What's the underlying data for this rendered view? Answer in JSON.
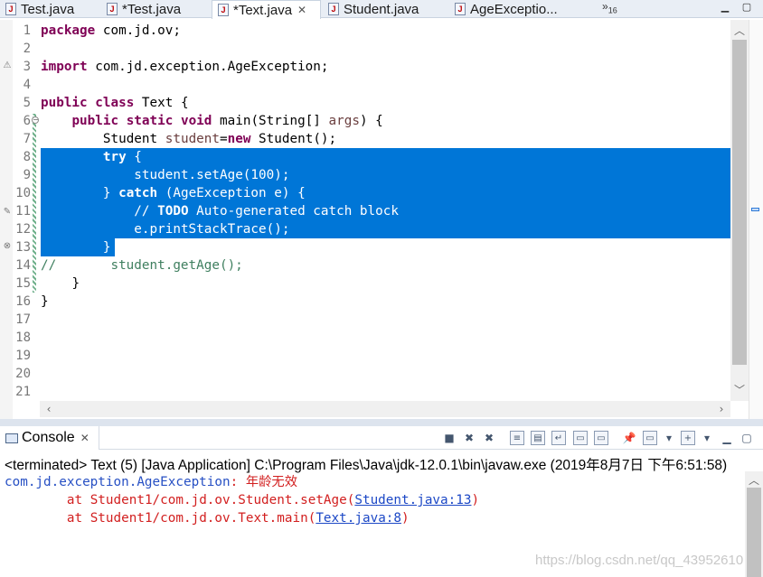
{
  "tabs": [
    {
      "label": "Test.java",
      "active": false,
      "icon": "java-file-icon"
    },
    {
      "label": "*Test.java",
      "active": false,
      "icon": "java-file-error-icon"
    },
    {
      "label": "*Text.java",
      "active": true,
      "icon": "java-file-icon"
    },
    {
      "label": "Student.java",
      "active": false,
      "icon": "java-file-icon"
    },
    {
      "label": "AgeExceptio...",
      "active": false,
      "icon": "java-file-icon"
    }
  ],
  "active_close": "✕",
  "tabs_more": {
    "symbol": "»",
    "count": "16"
  },
  "line_numbers": [
    "1",
    "2",
    "3",
    "4",
    "5",
    "6",
    "7",
    "8",
    "9",
    "10",
    "11",
    "12",
    "13",
    "14",
    "15",
    "16",
    "17",
    "18",
    "19",
    "20",
    "21"
  ],
  "code": {
    "l1_kw": "package",
    "l1_rest": " com.jd.ov;",
    "l3_kw": "import",
    "l3_rest": " com.jd.exception.AgeException;",
    "l5_kw1": "public",
    "l5_kw2": "class",
    "l5_rest": " Text {",
    "l6_kw1": "public",
    "l6_kw2": "static",
    "l6_kw3": "void",
    "l6_a": " main(String[] ",
    "l6_var": "args",
    "l6_b": ") {",
    "l7_a": "Student ",
    "l7_var": "student",
    "l7_b": "=",
    "l7_kw": "new",
    "l7_c": " Student();",
    "l8_kw": "try",
    "l8_rest": " {",
    "l9_text": "student.setAge(100);",
    "l10_a": "} ",
    "l10_kw": "catch",
    "l10_b": " (AgeException e) {",
    "l11_a": "// ",
    "l11_todo": "TODO",
    "l11_b": " Auto-generated catch block",
    "l12_text": "e.printStackTrace();",
    "l13_text": "}",
    "l14_text": "//       student.getAge();",
    "l15_text": "}",
    "l16_text": "}"
  },
  "console": {
    "tab_label": "Console",
    "tab_close": "✕",
    "title": "<terminated> Text (5) [Java Application] C:\\Program Files\\Java\\jdk-12.0.1\\bin\\javaw.exe (2019年8月7日 下午6:51:58)",
    "exception_class": "com.jd.exception.AgeException",
    "exception_msg": ": 年龄无效",
    "trace1_prefix": "\tat Student1/com.jd.ov.Student.setAge(",
    "trace1_link": "Student.java:13",
    "trace1_suffix": ")",
    "trace2_prefix": "\tat Student1/com.jd.ov.Text.main(",
    "trace2_link": "Text.java:8",
    "trace2_suffix": ")"
  },
  "watermark": "https://blog.csdn.net/qq_43952610",
  "colors": {
    "selection": "#0076d7",
    "keyword": "#7f0055",
    "comment": "#3f7f5f",
    "error_text": "#d21f1f",
    "link": "#1c48c6"
  }
}
